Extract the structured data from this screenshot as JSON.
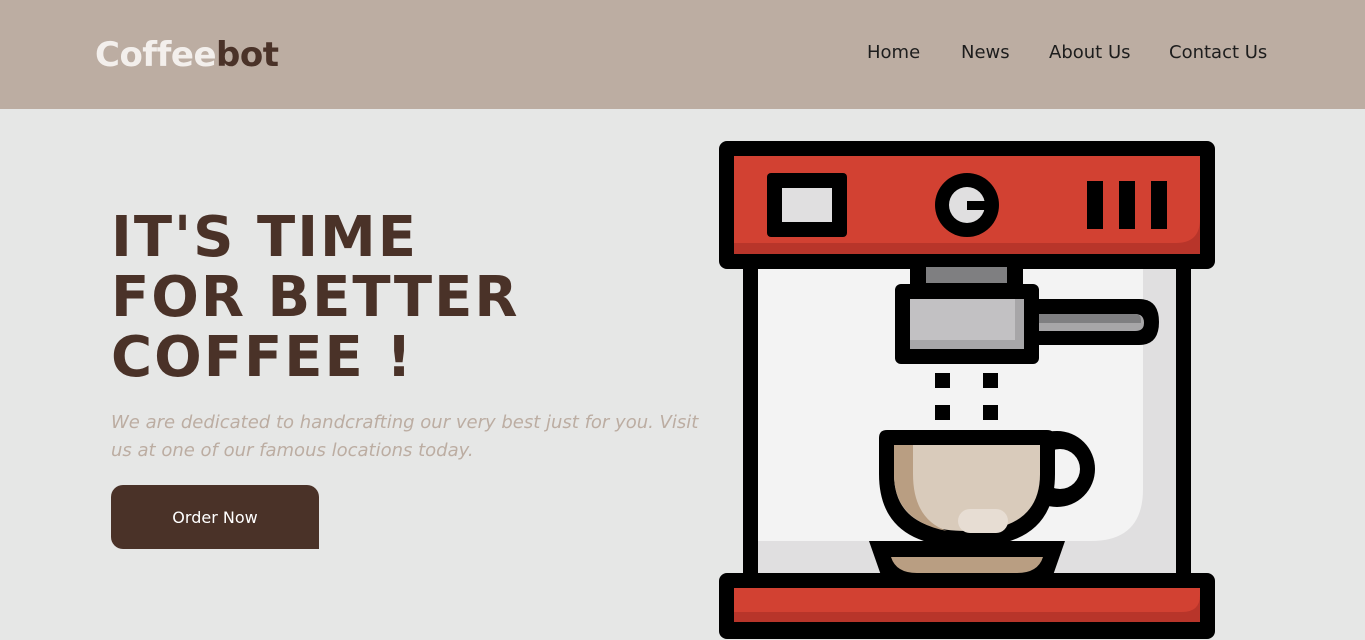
{
  "brand": {
    "part1": "Coffee",
    "part2": "bot"
  },
  "nav": {
    "items": [
      {
        "label": "Home"
      },
      {
        "label": "News"
      },
      {
        "label": "About Us"
      },
      {
        "label": "Contact Us"
      }
    ]
  },
  "hero": {
    "headline_lines": [
      "IT'S TIME",
      "FOR BETTER",
      "COFFEE !"
    ],
    "description": "We are dedicated to handcrafting our very best just for you. Visit us at one of our famous locations today.",
    "cta_label": "Order Now"
  },
  "colors": {
    "header_bg": "#bcada2",
    "page_bg": "#e6e7e6",
    "brand_dark": "#4a3228",
    "brand_light": "#f3efec",
    "machine_red": "#d24132",
    "coffee_cream": "#d9cbbb"
  },
  "illustration": {
    "icon": "espresso-machine-icon"
  }
}
